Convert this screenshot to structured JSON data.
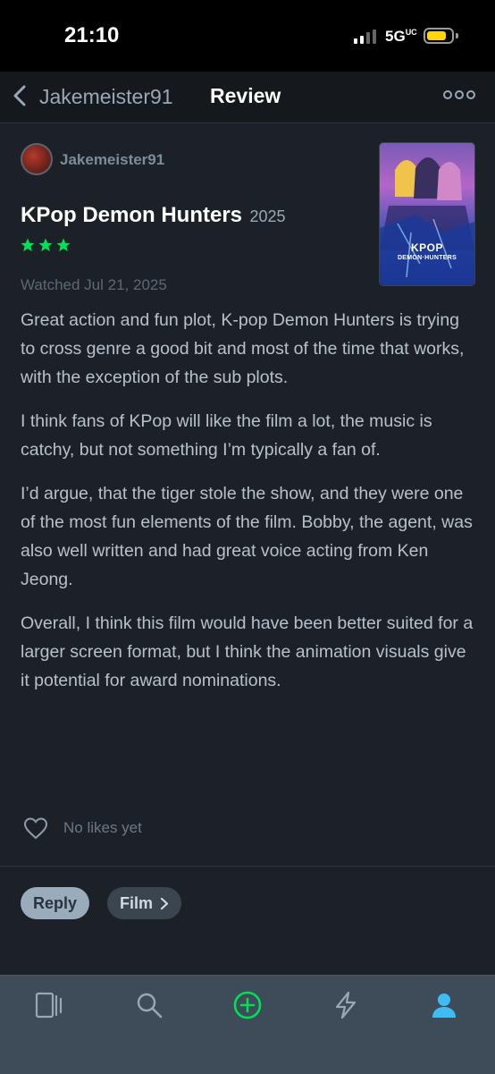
{
  "status": {
    "time": "21:10",
    "network": "5G",
    "network_sub": "UC"
  },
  "header": {
    "back_label": "Jakemeister91",
    "title": "Review"
  },
  "review": {
    "author": "Jakemeister91",
    "film_title": "KPop Demon Hunters",
    "film_year": "2025",
    "rating_stars": 3,
    "watched": "Watched Jul 21, 2025",
    "paragraphs": [
      "Great action and fun plot, K-pop Demon Hunters is trying to cross genre a good bit and most of the time that works, with the exception of the sub plots.",
      "I think fans of KPop will like the film a lot, the music is catchy, but not something I’m typically a fan of.",
      "I’d argue, that the tiger stole the show, and they were one of the most fun elements of the film. Bobby, the agent, was also well written and had great voice acting from Ken Jeong.",
      "Overall, I think this film would have been better suited for a larger screen format, but I think the animation visuals give it potential for award nominations."
    ],
    "likes_text": "No likes yet"
  },
  "poster": {
    "logo_main": "KPOP",
    "logo_sub": "DEMON·HUNTERS"
  },
  "actions": {
    "reply_label": "Reply",
    "film_label": "Film"
  },
  "tabs": [
    "films-icon",
    "search-icon",
    "add-icon",
    "activity-icon",
    "profile-icon"
  ],
  "colors": {
    "accent_green": "#00e054",
    "active_tab": "#40bcf4",
    "background": "#1c2127"
  }
}
